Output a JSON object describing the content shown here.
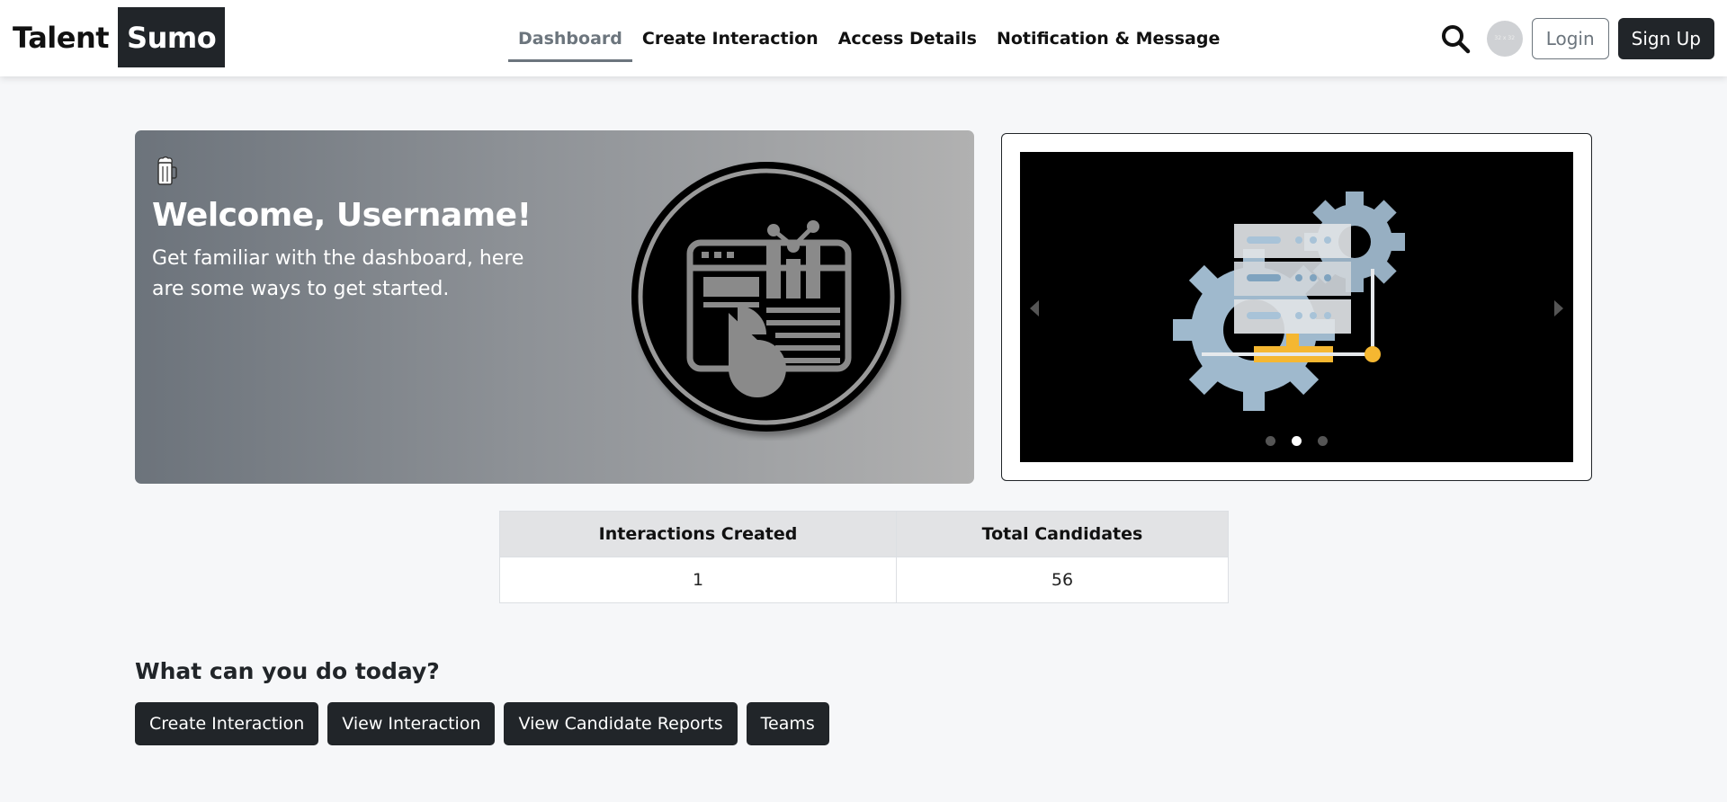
{
  "brand": {
    "part1": "Talent",
    "part2": "Sumo"
  },
  "nav": [
    {
      "label": "Dashboard",
      "active": true
    },
    {
      "label": "Create Interaction",
      "active": false
    },
    {
      "label": "Access Details",
      "active": false
    },
    {
      "label": "Notification & Message",
      "active": false
    }
  ],
  "header": {
    "login_label": "Login",
    "signup_label": "Sign Up",
    "avatar_text": "32 x 32"
  },
  "welcome": {
    "title": "Welcome, Username!",
    "text": "Get familiar with the dashboard, here are some ways to get started."
  },
  "carousel": {
    "slide_count": 3,
    "active_slide": 2
  },
  "stats": {
    "headers": [
      "Interactions Created",
      "Total Candidates"
    ],
    "values": [
      "1",
      "56"
    ]
  },
  "actions": {
    "title": "What can you do today?",
    "buttons": [
      "Create Interaction",
      "View Interaction",
      "View Candidate Reports",
      "Teams"
    ]
  },
  "colors": {
    "primary_dark": "#212529",
    "muted": "#6c757d",
    "background": "#f6f7f9",
    "accent_yellow": "#f5b731",
    "gear_blue": "#a8c3d8"
  }
}
